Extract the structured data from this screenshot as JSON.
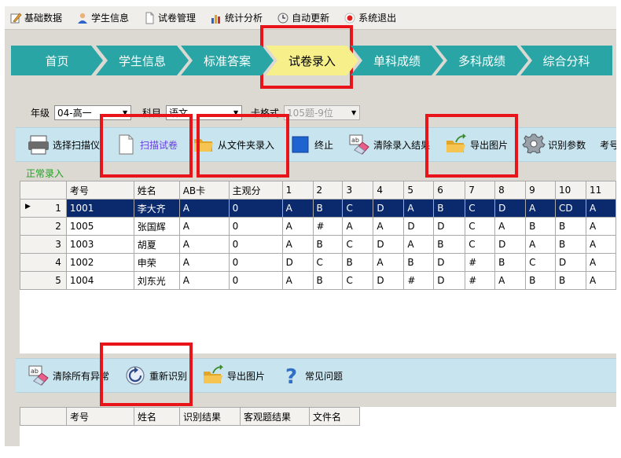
{
  "menu": [
    {
      "label": "基础数据",
      "icon": "pencil-icon"
    },
    {
      "label": "学生信息",
      "icon": "user-icon"
    },
    {
      "label": "试卷管理",
      "icon": "document-icon"
    },
    {
      "label": "统计分析",
      "icon": "bar-chart-icon"
    },
    {
      "label": "自动更新",
      "icon": "clock-icon"
    },
    {
      "label": "系统退出",
      "icon": "exit-icon"
    }
  ],
  "steps": [
    {
      "label": "首页",
      "active": false
    },
    {
      "label": "学生信息",
      "active": false
    },
    {
      "label": "标准答案",
      "active": false
    },
    {
      "label": "试卷录入",
      "active": true
    },
    {
      "label": "单科成绩",
      "active": false
    },
    {
      "label": "多科成绩",
      "active": false
    },
    {
      "label": "综合分科",
      "active": false
    }
  ],
  "filters": {
    "grade_label": "年级",
    "grade_value": "04-高一",
    "subject_label": "科目",
    "subject_value": "语文",
    "card_label": "卡格式",
    "card_value": "105题-9位"
  },
  "toolbar1": [
    {
      "label": "选择扫描仪",
      "icon": "scanner-icon"
    },
    {
      "label": "扫描试卷",
      "icon": "scan-document-icon"
    },
    {
      "label": "从文件夹录入",
      "icon": "folder-icon"
    },
    {
      "label": "终止",
      "icon": "stop-icon"
    },
    {
      "label": "清除录入结果",
      "icon": "eraser-icon"
    },
    {
      "label": "导出图片",
      "icon": "export-folder-icon"
    },
    {
      "label": "识别参数",
      "icon": "gear-icon"
    },
    {
      "label": "考号",
      "icon": ""
    }
  ],
  "status_text": "正常录入",
  "grid": {
    "columns": [
      "考号",
      "姓名",
      "AB卡",
      "主观分",
      "1",
      "2",
      "3",
      "4",
      "5",
      "6",
      "7",
      "8",
      "9",
      "10",
      "11"
    ],
    "rows": [
      {
        "n": "1",
        "cells": [
          "1001",
          "李大齐",
          "A",
          "0",
          "A",
          "B",
          "C",
          "D",
          "A",
          "B",
          "C",
          "D",
          "A",
          "CD",
          "A"
        ]
      },
      {
        "n": "2",
        "cells": [
          "1005",
          "张国辉",
          "A",
          "0",
          "A",
          "#",
          "A",
          "A",
          "D",
          "D",
          "C",
          "A",
          "B",
          "B",
          "A"
        ]
      },
      {
        "n": "3",
        "cells": [
          "1003",
          "胡夏",
          "A",
          "0",
          "A",
          "B",
          "C",
          "D",
          "A",
          "B",
          "C",
          "D",
          "A",
          "B",
          "A"
        ]
      },
      {
        "n": "4",
        "cells": [
          "1002",
          "申荣",
          "A",
          "0",
          "D",
          "C",
          "B",
          "A",
          "B",
          "D",
          "#",
          "B",
          "C",
          "D",
          "A"
        ]
      },
      {
        "n": "5",
        "cells": [
          "1004",
          "刘东光",
          "A",
          "0",
          "A",
          "B",
          "C",
          "D",
          "#",
          "D",
          "#",
          "A",
          "B",
          "B",
          "A"
        ]
      }
    ]
  },
  "toolbar2": [
    {
      "label": "清除所有异常",
      "icon": "eraser-icon"
    },
    {
      "label": "重新识别",
      "icon": "refresh-icon"
    },
    {
      "label": "导出图片",
      "icon": "export-folder-icon"
    },
    {
      "label": "常见问题",
      "icon": "help-icon"
    }
  ],
  "grid2": {
    "columns": [
      "考号",
      "姓名",
      "识别结果",
      "客观题结果",
      "文件名"
    ]
  },
  "colors": {
    "step_teal": "#2aa5a5",
    "step_active": "#f7f08a",
    "toolbar_bg": "#c8e4ee",
    "highlight": "#e8141a",
    "selected_row": "#0b2a6e",
    "status_green": "#1fa21f"
  }
}
